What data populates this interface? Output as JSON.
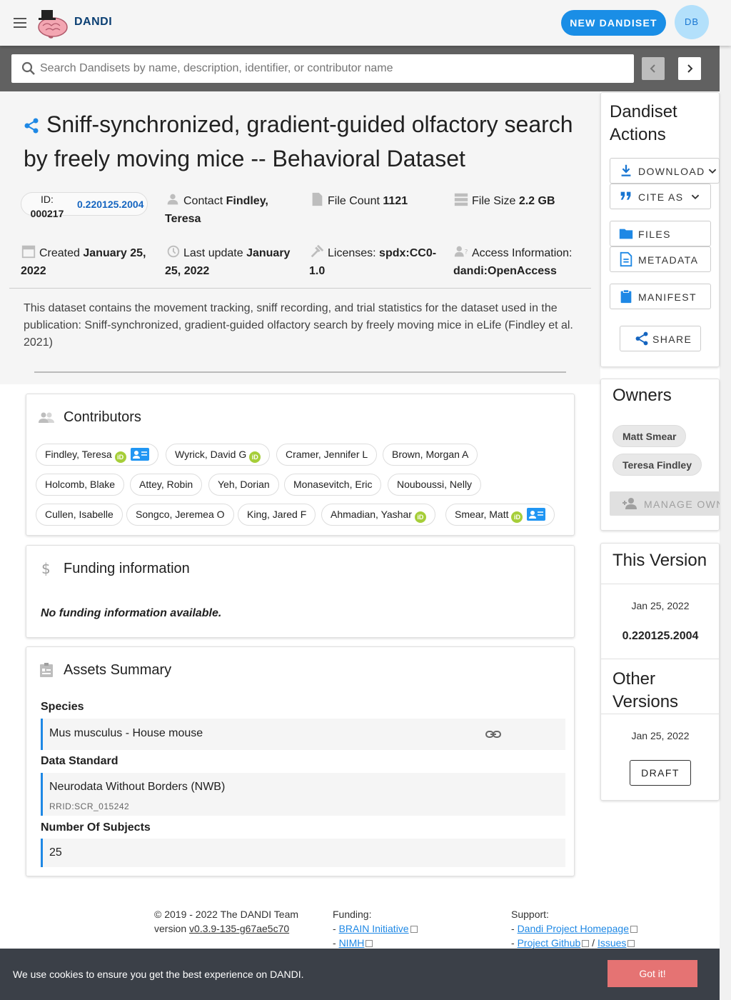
{
  "app": {
    "brand": "DANDI",
    "new_dandiset_label": "NEW DANDISET",
    "avatar_initials": "DB"
  },
  "search": {
    "placeholder": "Search Dandisets by name, description, identifier, or contributor name"
  },
  "dandiset": {
    "title": "Sniff-synchronized, gradient-guided olfactory search by freely moving mice -- Behavioral Dataset",
    "id_label": "ID:",
    "id": "000217",
    "version": "0.220125.2004",
    "contact_label": "Contact",
    "contact_name": "Findley, Teresa",
    "file_count_label": "File Count",
    "file_count": "1121",
    "file_size_label": "File Size",
    "file_size": "2.2 GB",
    "created_label": "Created",
    "created": "January 25, 2022",
    "last_update_label": "Last update",
    "last_update": "January 25, 2022",
    "licenses_label": "Licenses:",
    "license": "spdx:CC0-1.0",
    "access_label": "Access Information:",
    "access": "dandi:OpenAccess",
    "description": "This dataset contains the movement tracking, sniff recording, and trial statistics for the dataset used in the publication: Sniff-synchronized, gradient-guided olfactory search by freely moving mice in eLife (Findley et al. 2021)"
  },
  "actions": {
    "title": "Dandiset Actions",
    "download": "DOWNLOAD",
    "cite_as": "CITE AS",
    "files": "FILES",
    "metadata": "METADATA",
    "manifest": "MANIFEST",
    "share": "SHARE"
  },
  "owners": {
    "title": "Owners",
    "items": [
      "Matt Smear",
      "Teresa Findley"
    ],
    "manage_label": "MANAGE OWNERS"
  },
  "versions": {
    "this_title": "This Version",
    "this_date": "Jan 25, 2022",
    "this_version": "0.220125.2004",
    "other_title": "Other Versions",
    "other_date": "Jan 25, 2022",
    "draft_label": "DRAFT"
  },
  "contributors": {
    "title": "Contributors",
    "items": [
      {
        "name": "Findley, Teresa"
      },
      {
        "name": "Wyrick, David G"
      },
      {
        "name": "Cramer, Jennifer L"
      },
      {
        "name": "Brown, Morgan A"
      },
      {
        "name": "Holcomb, Blake"
      },
      {
        "name": "Attey, Robin"
      },
      {
        "name": "Yeh, Dorian"
      },
      {
        "name": "Monasevitch, Eric"
      },
      {
        "name": "Nouboussi, Nelly"
      },
      {
        "name": "Cullen, Isabelle"
      },
      {
        "name": "Songco, Jeremea O"
      },
      {
        "name": "King, Jared F"
      },
      {
        "name": "Ahmadian, Yashar"
      },
      {
        "name": "Smear, Matt"
      }
    ]
  },
  "funding": {
    "title": "Funding information",
    "empty": "No funding information available."
  },
  "assets": {
    "title": "Assets Summary",
    "species_label": "Species",
    "species": "Mus musculus - House mouse",
    "standard_label": "Data Standard",
    "standard": "Neurodata Without Borders (NWB)",
    "standard_rrid": "RRID:SCR_015242",
    "subjects_label": "Number Of Subjects",
    "subjects": "25"
  },
  "footer": {
    "copyright": "© 2019 - 2022 The DANDI Team",
    "version_label": "version",
    "version": "v0.3.9-135-g67ae5c70",
    "funding_label": "Funding:",
    "funding_links": [
      "BRAIN Initiative",
      "NIMH"
    ],
    "support_label": "Support:",
    "support_homepage": "Dandi Project Homepage",
    "support_github": "Project Github",
    "support_issues": "Issues"
  },
  "cookie": {
    "text": "We use cookies to ensure you get the best experience on DANDI.",
    "button": "Got it!"
  },
  "colors": {
    "accent": "#1a8ee6",
    "toolbar": "#616161",
    "cookie_bg": "#3b4048",
    "cookie_btn": "#e57373"
  }
}
